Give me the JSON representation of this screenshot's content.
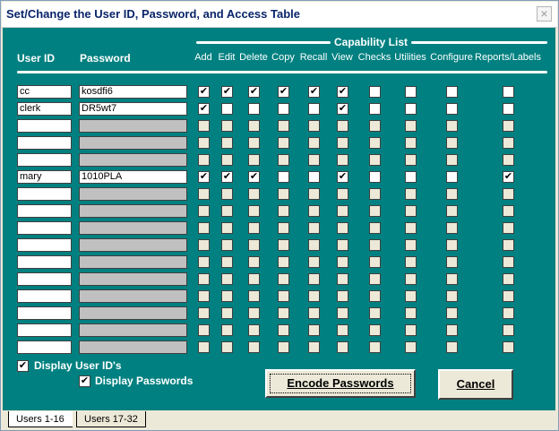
{
  "window": {
    "title": "Set/Change the User ID, Password, and Access Table",
    "close_glyph": "×"
  },
  "headers": {
    "user_id": "User ID",
    "password": "Password",
    "capability_list": "Capability List"
  },
  "capabilities": [
    "Add",
    "Edit",
    "Delete",
    "Copy",
    "Recall",
    "View",
    "Checks",
    "Utilities",
    "Configure",
    "Reports/Labels"
  ],
  "users": [
    {
      "user_id": "cc",
      "password": "kosdfi6",
      "caps": [
        true,
        true,
        true,
        true,
        true,
        true,
        false,
        false,
        false,
        false
      ]
    },
    {
      "user_id": "clerk",
      "password": "DR5wt7",
      "caps": [
        true,
        false,
        false,
        false,
        false,
        true,
        false,
        false,
        false,
        false
      ]
    },
    {
      "user_id": "",
      "password": "",
      "caps": [
        false,
        false,
        false,
        false,
        false,
        false,
        false,
        false,
        false,
        false
      ]
    },
    {
      "user_id": "",
      "password": "",
      "caps": [
        false,
        false,
        false,
        false,
        false,
        false,
        false,
        false,
        false,
        false
      ]
    },
    {
      "user_id": "",
      "password": "",
      "caps": [
        false,
        false,
        false,
        false,
        false,
        false,
        false,
        false,
        false,
        false
      ]
    },
    {
      "user_id": "mary",
      "password": "1010PLA",
      "caps": [
        true,
        true,
        true,
        false,
        false,
        true,
        false,
        false,
        false,
        true
      ]
    },
    {
      "user_id": "",
      "password": "",
      "caps": [
        false,
        false,
        false,
        false,
        false,
        false,
        false,
        false,
        false,
        false
      ]
    },
    {
      "user_id": "",
      "password": "",
      "caps": [
        false,
        false,
        false,
        false,
        false,
        false,
        false,
        false,
        false,
        false
      ]
    },
    {
      "user_id": "",
      "password": "",
      "caps": [
        false,
        false,
        false,
        false,
        false,
        false,
        false,
        false,
        false,
        false
      ]
    },
    {
      "user_id": "",
      "password": "",
      "caps": [
        false,
        false,
        false,
        false,
        false,
        false,
        false,
        false,
        false,
        false
      ]
    },
    {
      "user_id": "",
      "password": "",
      "caps": [
        false,
        false,
        false,
        false,
        false,
        false,
        false,
        false,
        false,
        false
      ]
    },
    {
      "user_id": "",
      "password": "",
      "caps": [
        false,
        false,
        false,
        false,
        false,
        false,
        false,
        false,
        false,
        false
      ]
    },
    {
      "user_id": "",
      "password": "",
      "caps": [
        false,
        false,
        false,
        false,
        false,
        false,
        false,
        false,
        false,
        false
      ]
    },
    {
      "user_id": "",
      "password": "",
      "caps": [
        false,
        false,
        false,
        false,
        false,
        false,
        false,
        false,
        false,
        false
      ]
    },
    {
      "user_id": "",
      "password": "",
      "caps": [
        false,
        false,
        false,
        false,
        false,
        false,
        false,
        false,
        false,
        false
      ]
    },
    {
      "user_id": "",
      "password": "",
      "caps": [
        false,
        false,
        false,
        false,
        false,
        false,
        false,
        false,
        false,
        false
      ]
    }
  ],
  "options": {
    "display_user_ids": {
      "label": "Display User ID's",
      "checked": true
    },
    "display_passwords": {
      "label": "Display Passwords",
      "checked": true
    }
  },
  "buttons": {
    "encode": "Encode Passwords",
    "cancel": "Cancel"
  },
  "tabs": [
    {
      "label": "Users 1-16",
      "active": true
    },
    {
      "label": "Users 17-32",
      "active": false
    }
  ],
  "check_glyph": "✔",
  "colors": {
    "panel": "#008080",
    "title_text": "#0a246a"
  }
}
